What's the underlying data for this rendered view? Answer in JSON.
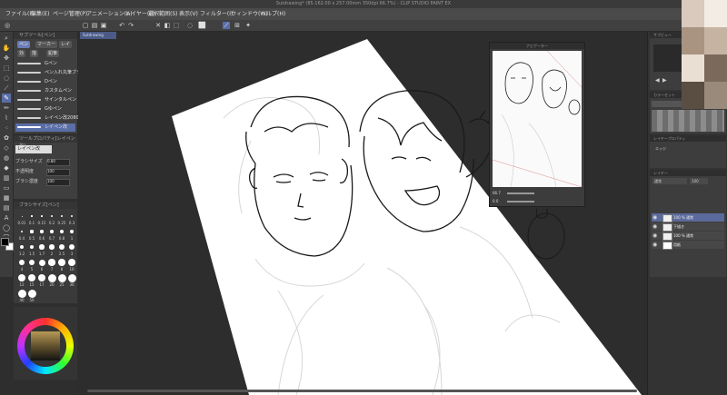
{
  "window": {
    "title": "Sutdrawing* (85.162.00 x 257.00mm 350dpi 66.7%) - CLIP STUDIO PAINT EX"
  },
  "menu": [
    {
      "label": "ファイル(F)"
    },
    {
      "label": "編集(E)"
    },
    {
      "label": "ページ管理(P)"
    },
    {
      "label": "アニメーション(A)"
    },
    {
      "label": "レイヤー(L)"
    },
    {
      "label": "選択範囲(S)"
    },
    {
      "label": "表示(V)"
    },
    {
      "label": "フィルター(I)"
    },
    {
      "label": "ウィンドウ(W)"
    },
    {
      "label": "ヘルプ(H)"
    }
  ],
  "canvas_tab": {
    "label": "Sutdrawing"
  },
  "subtool": {
    "header": "サブツール[ペン]",
    "groups": [
      {
        "label": "ペン",
        "selected": true
      },
      {
        "label": "マーカー",
        "selected": false
      },
      {
        "label": "レイ",
        "selected": false
      },
      {
        "label": "効",
        "selected": false
      },
      {
        "label": "描",
        "selected": false
      },
      {
        "label": "鉛筆",
        "selected": false
      }
    ],
    "brushes": [
      {
        "name": "Gペン",
        "selected": false
      },
      {
        "name": "ペン入れ丸筆ブラシ",
        "selected": false
      },
      {
        "name": "Dペン",
        "selected": false
      },
      {
        "name": "カスタムペン",
        "selected": false
      },
      {
        "name": "サインタルペン",
        "selected": false
      },
      {
        "name": "Gゆペン",
        "selected": false
      },
      {
        "name": "レイペン改2080",
        "selected": false
      },
      {
        "name": "レイペン改",
        "selected": true
      }
    ]
  },
  "tool_property": {
    "header": "ツールプロパティ[レイペン改]",
    "brush_label": "レイペン改",
    "rows": [
      {
        "label": "ブラシサイズ",
        "value": "0.80"
      },
      {
        "label": "不透明度",
        "value": "100"
      },
      {
        "label": "ブラシ濃度",
        "value": "100"
      }
    ]
  },
  "brush_size": {
    "header": "ブラシサイズ[ペン]",
    "sizes": [
      "0.01",
      "0.1",
      "0.15",
      "0.2",
      "0.25",
      "0.3",
      "0.4",
      "0.5",
      "0.6",
      "0.7",
      "0.8",
      "1",
      "1.2",
      "1.5",
      "1.7",
      "2",
      "2.5",
      "3",
      "4",
      "5",
      "6",
      "7",
      "8",
      "10",
      "12",
      "15",
      "17",
      "20",
      "25",
      "30",
      "40",
      "50"
    ]
  },
  "color": {
    "main": "#000000",
    "sub": "#ffffff",
    "wheel_value": "#8a7040"
  },
  "navigator": {
    "title": "ナビゲーター",
    "zoom": "66.7",
    "rotation": "0.0"
  },
  "right_panels": {
    "subview": "サブビュー",
    "color_set": "カラーセット",
    "layer_property": "レイヤープロパティ",
    "layer_property_mode": "エッジ",
    "layer_header": "レイヤー",
    "blend_mode": "通常",
    "opacity": "100",
    "layers": [
      {
        "name": "100 % 通常",
        "selected": true
      },
      {
        "name": "下描き",
        "selected": false
      },
      {
        "name": "100 % 通常",
        "selected": false
      },
      {
        "name": "用紙",
        "selected": false
      }
    ]
  }
}
